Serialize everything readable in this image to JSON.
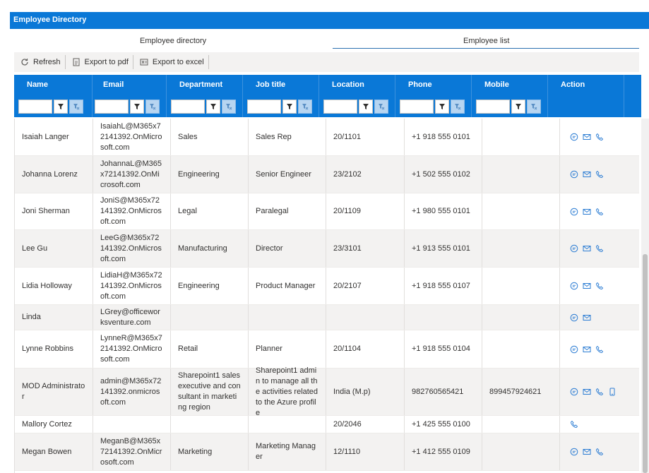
{
  "window": {
    "title": "Employee Directory"
  },
  "tabs": [
    {
      "label": "Employee directory",
      "active": false
    },
    {
      "label": "Employee list",
      "active": true
    }
  ],
  "toolbar": {
    "refresh_label": "Refresh",
    "export_pdf_label": "Export to pdf",
    "export_excel_label": "Export to excel"
  },
  "columns": [
    "Name",
    "Email",
    "Department",
    "Job title",
    "Location",
    "Phone",
    "Mobile",
    "Action"
  ],
  "rows": [
    {
      "name": "Isaiah Langer",
      "email": "IsaiahL@M365x72141392.OnMicrosoft.com",
      "department": "Sales",
      "job_title": "Sales Rep",
      "location": "20/1101",
      "phone": "+1 918 555 0101",
      "mobile": "",
      "actions": [
        "chat",
        "mail",
        "call"
      ]
    },
    {
      "name": "Johanna Lorenz",
      "email": "JohannaL@M365x72141392.OnMicrosoft.com",
      "department": "Engineering",
      "job_title": "Senior Engineer",
      "location": "23/2102",
      "phone": "+1 502 555 0102",
      "mobile": "",
      "actions": [
        "chat",
        "mail",
        "call"
      ]
    },
    {
      "name": "Joni Sherman",
      "email": "JoniS@M365x72141392.OnMicrosoft.com",
      "department": "Legal",
      "job_title": "Paralegal",
      "location": "20/1109",
      "phone": "+1 980 555 0101",
      "mobile": "",
      "actions": [
        "chat",
        "mail",
        "call"
      ]
    },
    {
      "name": "Lee Gu",
      "email": "LeeG@M365x72141392.OnMicrosoft.com",
      "department": "Manufacturing",
      "job_title": "Director",
      "location": "23/3101",
      "phone": "+1 913 555 0101",
      "mobile": "",
      "actions": [
        "chat",
        "mail",
        "call"
      ]
    },
    {
      "name": "Lidia Holloway",
      "email": "LidiaH@M365x72141392.OnMicrosoft.com",
      "department": "Engineering",
      "job_title": "Product Manager",
      "location": "20/2107",
      "phone": "+1 918 555 0107",
      "mobile": "",
      "actions": [
        "chat",
        "mail",
        "call"
      ]
    },
    {
      "name": "Linda",
      "email": "LGrey@officeworksventure.com",
      "department": "",
      "job_title": "",
      "location": "",
      "phone": "",
      "mobile": "",
      "actions": [
        "chat",
        "mail"
      ]
    },
    {
      "name": "Lynne Robbins",
      "email": "LynneR@M365x72141392.OnMicrosoft.com",
      "department": "Retail",
      "job_title": "Planner",
      "location": "20/1104",
      "phone": "+1 918 555 0104",
      "mobile": "",
      "actions": [
        "chat",
        "mail",
        "call"
      ]
    },
    {
      "name": "MOD Administrator",
      "email": "admin@M365x72141392.onmicrosoft.com",
      "department": "Sharepoint1 sales executive and consultant in marketing region",
      "job_title": "Sharepoint1 admin to manage all the activities related to the Azure profile",
      "location": "India (M.p)",
      "phone": "982760565421",
      "mobile": "899457924621",
      "actions": [
        "chat",
        "mail",
        "call",
        "mobile"
      ]
    },
    {
      "name": "Mallory Cortez",
      "email": "",
      "department": "",
      "job_title": "",
      "location": "20/2046",
      "phone": "+1 425 555 0100",
      "mobile": "",
      "actions": [
        "call"
      ]
    },
    {
      "name": "Megan Bowen",
      "email": "MeganB@M365x72141392.OnMicrosoft.com",
      "department": "Marketing",
      "job_title": "Marketing Manager",
      "location": "12/1110",
      "phone": "+1 412 555 0109",
      "mobile": "",
      "actions": [
        "chat",
        "mail",
        "call"
      ]
    }
  ],
  "colors": {
    "accent": "#0a78d7",
    "alt_row": "#f3f2f1",
    "icon": "#2b7cd3"
  }
}
